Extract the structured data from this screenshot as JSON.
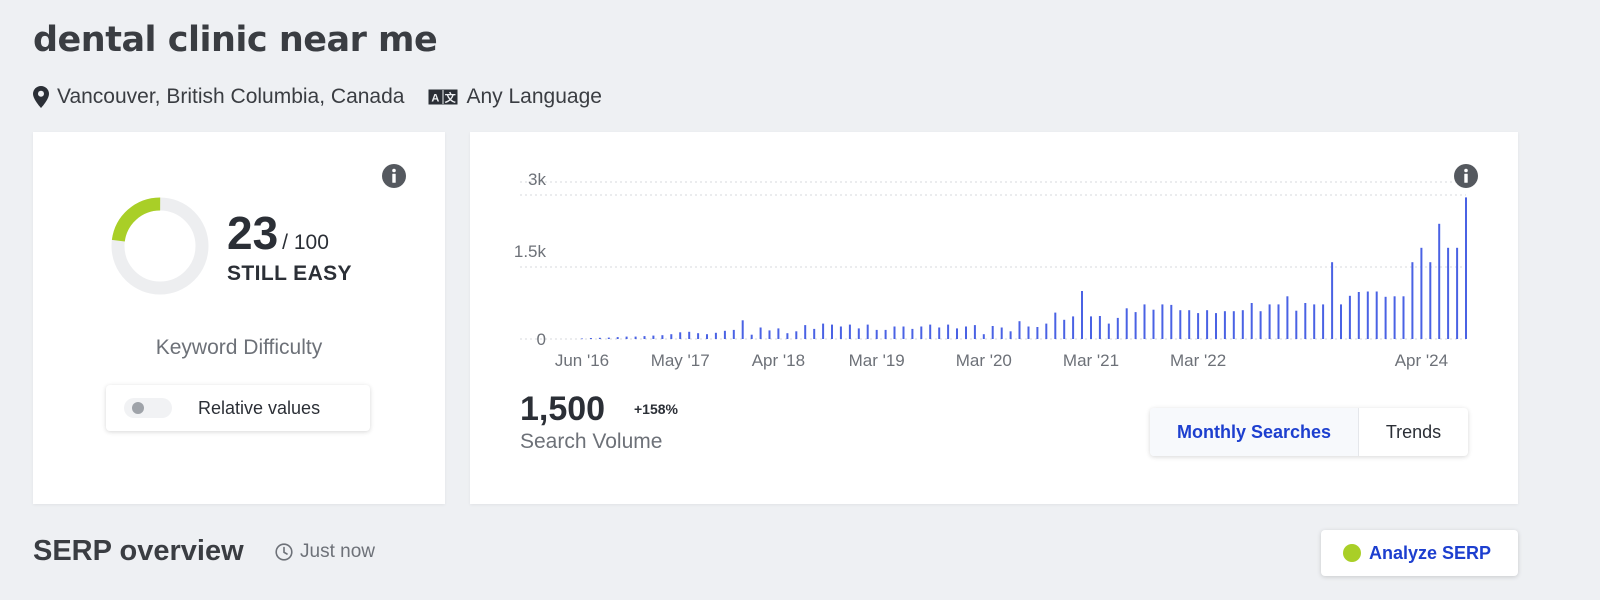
{
  "page": {
    "title": "dental clinic near me",
    "location": "Vancouver, British Columbia, Canada",
    "language": "Any Language"
  },
  "colors": {
    "accent_blue": "#1d3fcf",
    "bar_blue": "#4a62e4",
    "difficulty_green": "#a9cf27",
    "ring_track": "#edeef0"
  },
  "icons": {
    "location": "map-pin-icon",
    "language": "language-icon",
    "info": "info-icon",
    "clock": "clock-icon"
  },
  "keyword_difficulty": {
    "score": "23",
    "max": "/ 100",
    "score_value": 23,
    "score_max": 100,
    "level": "STILL EASY",
    "label": "Keyword Difficulty",
    "toggle_label": "Relative values",
    "toggle_on": false
  },
  "search_volume": {
    "value": "1,500",
    "change": "+158%",
    "label": "Search Volume",
    "tabs": [
      {
        "label": "Monthly Searches",
        "active": true
      },
      {
        "label": "Trends",
        "active": false
      }
    ]
  },
  "chart_data": {
    "type": "bar",
    "y_ticks": [
      {
        "value": 0,
        "label": "0"
      },
      {
        "value": 1500,
        "label": "1.5k"
      },
      {
        "value": 3000,
        "label": "3k"
      }
    ],
    "x_labels": [
      {
        "index": 0,
        "label": "Jun '16"
      },
      {
        "index": 11,
        "label": "May '17"
      },
      {
        "index": 22,
        "label": "Apr '18"
      },
      {
        "index": 33,
        "label": "Mar '19"
      },
      {
        "index": 45,
        "label": "Mar '20"
      },
      {
        "index": 57,
        "label": "Mar '21"
      },
      {
        "index": 69,
        "label": "Mar '22"
      },
      {
        "index": 94,
        "label": "Apr '24"
      }
    ],
    "ylim": [
      0,
      3000
    ],
    "grid": true,
    "values": [
      10,
      20,
      25,
      30,
      40,
      50,
      50,
      60,
      70,
      80,
      100,
      140,
      150,
      120,
      100,
      130,
      170,
      190,
      390,
      90,
      240,
      180,
      220,
      120,
      160,
      290,
      210,
      320,
      300,
      260,
      300,
      220,
      300,
      190,
      190,
      260,
      260,
      210,
      260,
      300,
      240,
      300,
      220,
      260,
      290,
      100,
      270,
      240,
      160,
      370,
      260,
      250,
      320,
      550,
      400,
      470,
      1000,
      470,
      480,
      320,
      440,
      640,
      560,
      720,
      610,
      720,
      710,
      600,
      600,
      540,
      600,
      540,
      580,
      580,
      600,
      750,
      580,
      720,
      720,
      890,
      590,
      750,
      720,
      720,
      1600,
      720,
      900,
      980,
      990,
      990,
      880,
      890,
      890,
      1600,
      1900,
      1600,
      2400,
      1900,
      1900,
      2950
    ]
  },
  "serp": {
    "title": "SERP overview",
    "timestamp": "Just now",
    "analyze_label": "Analyze SERP"
  }
}
